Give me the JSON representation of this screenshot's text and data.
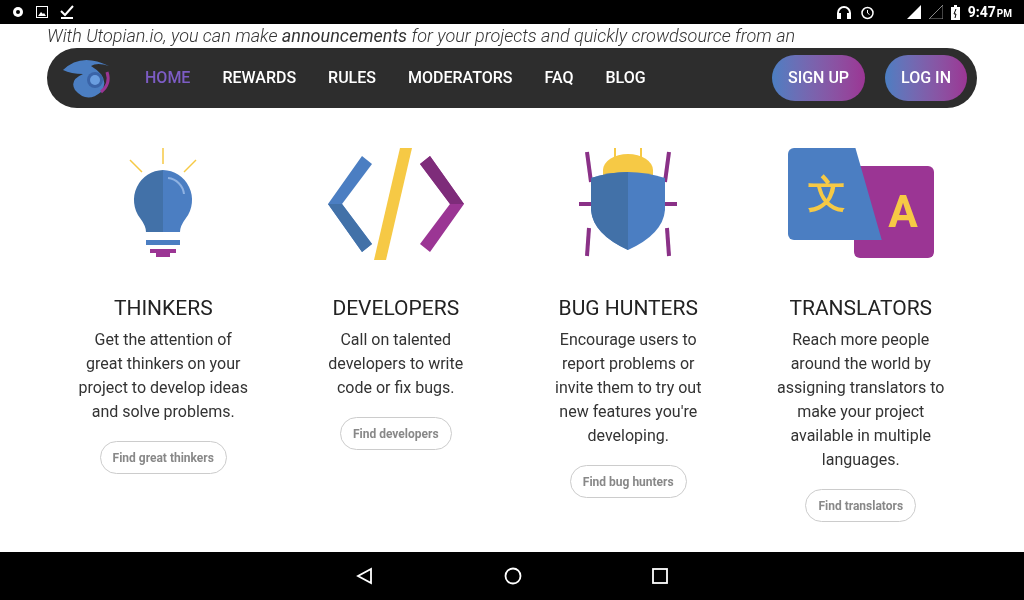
{
  "status_bar": {
    "time": "9:47",
    "ampm": "PM"
  },
  "intro": {
    "lines": [
      "With Utopian.io, you can make **announcements** for your projects and quickly crowdsource from an"
    ]
  },
  "nav": {
    "links": [
      {
        "label": "HOME",
        "selected": true
      },
      {
        "label": "REWARDS",
        "selected": false
      },
      {
        "label": "RULES",
        "selected": false
      },
      {
        "label": "MODERATORS",
        "selected": false
      },
      {
        "label": "FAQ",
        "selected": false
      },
      {
        "label": "BLOG",
        "selected": false
      }
    ],
    "buttons": [
      "SIGN UP",
      "LOG IN"
    ]
  },
  "cards": [
    {
      "kind": "bulb",
      "title": "THINKERS",
      "description": "Get the attention of great thinkers on your project to develop ideas and solve problems.",
      "button": "Find great thinkers"
    },
    {
      "kind": "code",
      "title": "DEVELOPERS",
      "description": "Call on talented developers to write code or fix bugs.",
      "button": "Find developers"
    },
    {
      "kind": "bug",
      "title": "BUG HUNTERS",
      "description": "Encourage users to report problems or invite them to try out new features you're developing.",
      "button": "Find bug hunters"
    },
    {
      "kind": "translate",
      "title": "TRANSLATORS",
      "description": "Reach more people around the world by assigning translators to make your project available in multiple languages.",
      "button": "Find translators",
      "glyphs": [
        "文",
        "A"
      ]
    }
  ]
}
